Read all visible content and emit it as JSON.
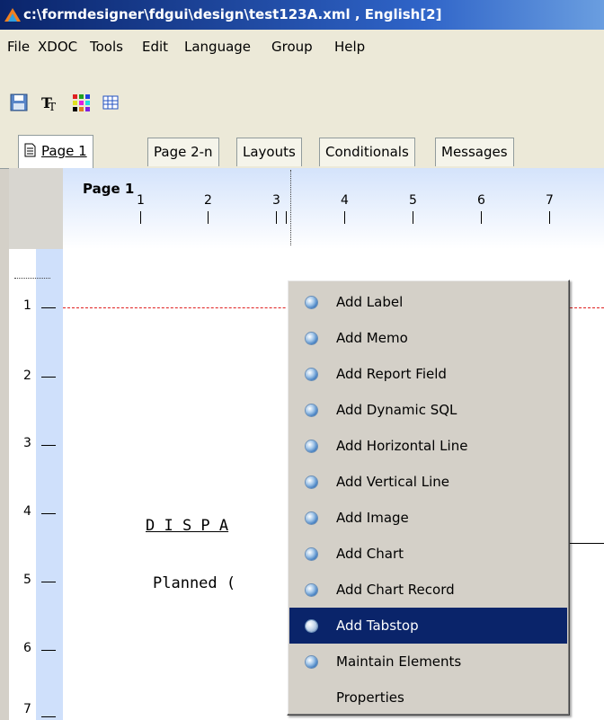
{
  "window": {
    "title": "c:\\formdesigner\\fdgui\\design\\test123A.xml , English[2]"
  },
  "menubar": {
    "items": [
      "File",
      "XDOC",
      "Tools",
      "Edit",
      "Language",
      "Group",
      "Help"
    ]
  },
  "toolbar": {
    "icons": [
      "save-icon",
      "font-icon",
      "color-palette-icon",
      "grid-icon"
    ]
  },
  "tabs": [
    {
      "label": "Page 1",
      "active": true
    },
    {
      "label": "Page 2-n",
      "active": false
    },
    {
      "label": "Layouts",
      "active": false
    },
    {
      "label": "Conditionals",
      "active": false
    },
    {
      "label": "Messages",
      "active": false
    }
  ],
  "ruler": {
    "page_label": "Page 1",
    "h_numbers": [
      "1",
      "2",
      "3",
      "4",
      "5",
      "6",
      "7"
    ],
    "v_numbers": [
      "1",
      "2",
      "3",
      "4",
      "5",
      "6",
      "7"
    ]
  },
  "document": {
    "line1": "D I S P A",
    "line2": "Planned ("
  },
  "context_menu": {
    "items": [
      {
        "label": "Add Label",
        "bullet": true,
        "highlighted": false
      },
      {
        "label": "Add Memo",
        "bullet": true,
        "highlighted": false
      },
      {
        "label": "Add Report Field",
        "bullet": true,
        "highlighted": false
      },
      {
        "label": "Add Dynamic SQL",
        "bullet": true,
        "highlighted": false
      },
      {
        "label": "Add Horizontal Line",
        "bullet": true,
        "highlighted": false
      },
      {
        "label": "Add Vertical Line",
        "bullet": true,
        "highlighted": false
      },
      {
        "label": "Add Image",
        "bullet": true,
        "highlighted": false
      },
      {
        "label": "Add Chart",
        "bullet": true,
        "highlighted": false
      },
      {
        "label": "Add Chart Record",
        "bullet": true,
        "highlighted": false
      },
      {
        "label": "Add Tabstop",
        "bullet": true,
        "highlighted": true
      },
      {
        "label": "Maintain Elements",
        "bullet": true,
        "highlighted": false
      },
      {
        "label": "Properties",
        "bullet": false,
        "highlighted": false
      }
    ]
  },
  "colors": {
    "titlebar": "#0a246a",
    "highlight": "#0a246a",
    "guide_line": "#e02020"
  }
}
